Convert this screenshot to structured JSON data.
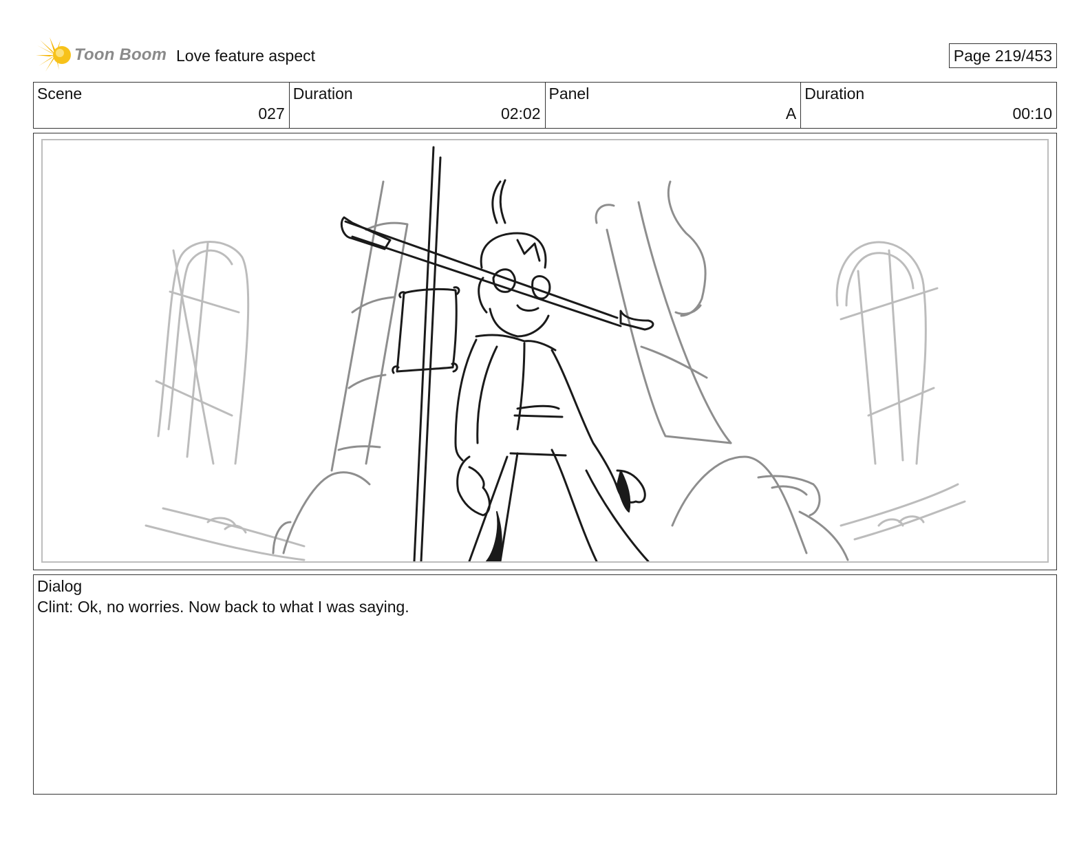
{
  "header": {
    "logo_text": "Toon Boom",
    "project_title": "Love feature aspect",
    "page_label": "Page 219/453"
  },
  "info": {
    "scene_label": "Scene",
    "scene_value": "027",
    "scene_duration_label": "Duration",
    "scene_duration_value": "02:02",
    "panel_label": "Panel",
    "panel_value": "A",
    "panel_duration_label": "Duration",
    "panel_duration_value": "00:10"
  },
  "dialog": {
    "label": "Dialog",
    "text": "Clint: Ok, no worries. Now back to what I was saying."
  },
  "colors": {
    "logo_star": "#f5b400",
    "logo_text": "#8a8a8a",
    "border": "#333333",
    "sketch_light": "#b5b5b5",
    "sketch_mid": "#8e8e8e",
    "sketch_dark": "#1a1a1a"
  }
}
